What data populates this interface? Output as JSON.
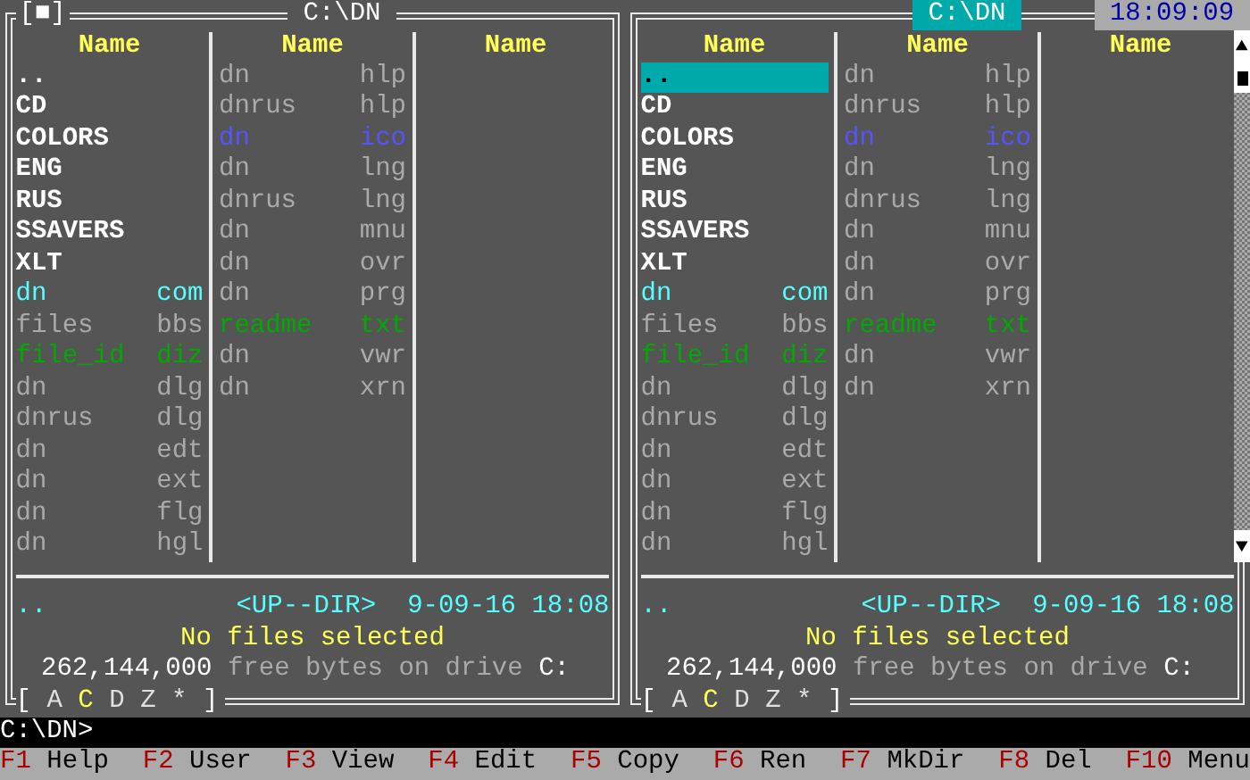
{
  "clock": "18:09:09",
  "panels": [
    {
      "close_button": "[■]",
      "title": "C:\\DN",
      "active": false,
      "headers": [
        "Name",
        "Name",
        "Name"
      ],
      "files": [
        {
          "name": "..",
          "color": "#ffffff",
          "selected": false
        },
        {
          "name": "CD",
          "color": "#ffffff",
          "selected": false
        },
        {
          "name": "COLORS",
          "color": "#ffffff",
          "selected": false
        },
        {
          "name": "ENG",
          "color": "#ffffff",
          "selected": false
        },
        {
          "name": "RUS",
          "color": "#ffffff",
          "selected": false
        },
        {
          "name": "SSAVERS",
          "color": "#ffffff",
          "selected": false
        },
        {
          "name": "XLT",
          "color": "#ffffff",
          "selected": false
        },
        {
          "name": "dn",
          "ext": "com",
          "color": "#55ffff",
          "selected": false
        },
        {
          "name": "files",
          "ext": "bbs",
          "color": "#aaaaaa",
          "selected": false
        },
        {
          "name": "file_id",
          "ext": "diz",
          "color": "#00aa00",
          "selected": false
        },
        {
          "name": "dn",
          "ext": "dlg",
          "color": "#aaaaaa",
          "selected": false
        },
        {
          "name": "dnrus",
          "ext": "dlg",
          "color": "#aaaaaa",
          "selected": false
        },
        {
          "name": "dn",
          "ext": "edt",
          "color": "#aaaaaa",
          "selected": false
        },
        {
          "name": "dn",
          "ext": "ext",
          "color": "#aaaaaa",
          "selected": false
        },
        {
          "name": "dn",
          "ext": "flg",
          "color": "#aaaaaa",
          "selected": false
        },
        {
          "name": "dn",
          "ext": "hgl",
          "color": "#aaaaaa",
          "selected": false
        },
        {
          "name": "dn",
          "ext": "hlp",
          "color": "#aaaaaa",
          "selected": false
        },
        {
          "name": "dnrus",
          "ext": "hlp",
          "color": "#aaaaaa",
          "selected": false
        },
        {
          "name": "dn",
          "ext": "ico",
          "color": "#5555ff",
          "selected": false
        },
        {
          "name": "dn",
          "ext": "lng",
          "color": "#aaaaaa",
          "selected": false
        },
        {
          "name": "dnrus",
          "ext": "lng",
          "color": "#aaaaaa",
          "selected": false
        },
        {
          "name": "dn",
          "ext": "mnu",
          "color": "#aaaaaa",
          "selected": false
        },
        {
          "name": "dn",
          "ext": "ovr",
          "color": "#aaaaaa",
          "selected": false
        },
        {
          "name": "dn",
          "ext": "prg",
          "color": "#aaaaaa",
          "selected": false
        },
        {
          "name": "readme",
          "ext": "txt",
          "color": "#00aa00",
          "selected": false
        },
        {
          "name": "dn",
          "ext": "vwr",
          "color": "#aaaaaa",
          "selected": false
        },
        {
          "name": "dn",
          "ext": "xrn",
          "color": "#aaaaaa",
          "selected": false
        }
      ],
      "info": {
        "name": "..",
        "type": "<UP--DIR>",
        "date": "9-09-16",
        "time": "18:08"
      },
      "selection": "No files selected",
      "free": {
        "bytes": "262,144,000",
        "text": "free bytes on drive",
        "drive": "C:"
      },
      "drives": {
        "open": "[",
        "close": "]",
        "items": [
          {
            "letter": "A",
            "selected": false
          },
          {
            "letter": "C",
            "selected": true
          },
          {
            "letter": "D",
            "selected": false
          },
          {
            "letter": "Z",
            "selected": false
          },
          {
            "letter": "*",
            "selected": false
          }
        ]
      }
    },
    {
      "title": "C:\\DN",
      "active": true,
      "headers": [
        "Name",
        "Name",
        "Name"
      ],
      "files": [
        {
          "name": "..",
          "selected": true
        },
        {
          "name": "CD",
          "color": "#ffffff",
          "selected": false
        },
        {
          "name": "COLORS",
          "color": "#ffffff",
          "selected": false
        },
        {
          "name": "ENG",
          "color": "#ffffff",
          "selected": false
        },
        {
          "name": "RUS",
          "color": "#ffffff",
          "selected": false
        },
        {
          "name": "SSAVERS",
          "color": "#ffffff",
          "selected": false
        },
        {
          "name": "XLT",
          "color": "#ffffff",
          "selected": false
        },
        {
          "name": "dn",
          "ext": "com",
          "color": "#55ffff",
          "selected": false
        },
        {
          "name": "files",
          "ext": "bbs",
          "color": "#aaaaaa",
          "selected": false
        },
        {
          "name": "file_id",
          "ext": "diz",
          "color": "#00aa00",
          "selected": false
        },
        {
          "name": "dn",
          "ext": "dlg",
          "color": "#aaaaaa",
          "selected": false
        },
        {
          "name": "dnrus",
          "ext": "dlg",
          "color": "#aaaaaa",
          "selected": false
        },
        {
          "name": "dn",
          "ext": "edt",
          "color": "#aaaaaa",
          "selected": false
        },
        {
          "name": "dn",
          "ext": "ext",
          "color": "#aaaaaa",
          "selected": false
        },
        {
          "name": "dn",
          "ext": "flg",
          "color": "#aaaaaa",
          "selected": false
        },
        {
          "name": "dn",
          "ext": "hgl",
          "color": "#aaaaaa",
          "selected": false
        },
        {
          "name": "dn",
          "ext": "hlp",
          "color": "#aaaaaa",
          "selected": false
        },
        {
          "name": "dnrus",
          "ext": "hlp",
          "color": "#aaaaaa",
          "selected": false
        },
        {
          "name": "dn",
          "ext": "ico",
          "color": "#5555ff",
          "selected": false
        },
        {
          "name": "dn",
          "ext": "lng",
          "color": "#aaaaaa",
          "selected": false
        },
        {
          "name": "dnrus",
          "ext": "lng",
          "color": "#aaaaaa",
          "selected": false
        },
        {
          "name": "dn",
          "ext": "mnu",
          "color": "#aaaaaa",
          "selected": false
        },
        {
          "name": "dn",
          "ext": "ovr",
          "color": "#aaaaaa",
          "selected": false
        },
        {
          "name": "dn",
          "ext": "prg",
          "color": "#aaaaaa",
          "selected": false
        },
        {
          "name": "readme",
          "ext": "txt",
          "color": "#00aa00",
          "selected": false
        },
        {
          "name": "dn",
          "ext": "vwr",
          "color": "#aaaaaa",
          "selected": false
        },
        {
          "name": "dn",
          "ext": "xrn",
          "color": "#aaaaaa",
          "selected": false
        }
      ],
      "info": {
        "name": "..",
        "type": "<UP--DIR>",
        "date": "9-09-16",
        "time": "18:08"
      },
      "selection": "No files selected",
      "free": {
        "bytes": "262,144,000",
        "text": "free bytes on drive",
        "drive": "C:"
      },
      "drives": {
        "open": "[",
        "close": "]",
        "items": [
          {
            "letter": "A",
            "selected": false
          },
          {
            "letter": "C",
            "selected": true
          },
          {
            "letter": "D",
            "selected": false
          },
          {
            "letter": "Z",
            "selected": false
          },
          {
            "letter": "*",
            "selected": false
          }
        ]
      }
    }
  ],
  "command_line": "C:\\DN>",
  "function_keys": [
    {
      "key": "F1",
      "label": "Help"
    },
    {
      "key": "F2",
      "label": "User"
    },
    {
      "key": "F3",
      "label": "View"
    },
    {
      "key": "F4",
      "label": "Edit"
    },
    {
      "key": "F5",
      "label": "Copy"
    },
    {
      "key": "F6",
      "label": "Ren"
    },
    {
      "key": "F7",
      "label": "MkDir"
    },
    {
      "key": "F8",
      "label": "Del"
    },
    {
      "key": "F10",
      "label": "Menu"
    }
  ]
}
